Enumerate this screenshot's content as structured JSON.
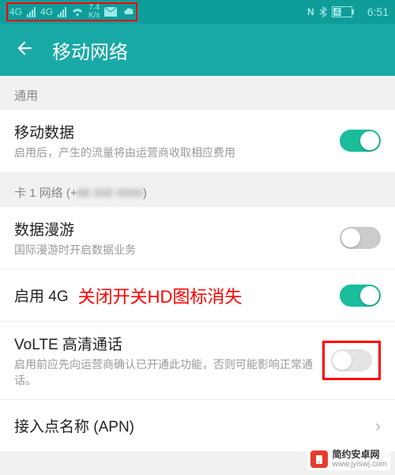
{
  "statusbar": {
    "network_type": "4G",
    "speed_value": "7.4",
    "speed_unit": "K/s",
    "nfc": "N",
    "battery_pct": "43",
    "time": "6:51"
  },
  "appbar": {
    "title": "移动网络"
  },
  "sections": {
    "general_label": "通用",
    "card1_prefix": "卡 1 网络 (+",
    "card1_number_blurred": "86 000 0000",
    "card1_suffix": ")"
  },
  "rows": {
    "mobile_data": {
      "title": "移动数据",
      "sub": "启用后，产生的流量将由运营商收取相应费用",
      "on": true
    },
    "roaming": {
      "title": "数据漫游",
      "sub": "国际漫游时开启数据业务",
      "on": false
    },
    "enable4g": {
      "title": "启用 4G",
      "annotation": "关闭开关HD图标消失",
      "on": true
    },
    "volte": {
      "title": "VoLTE 高清通话",
      "sub": "启用前应先向运营商确认已开通此功能，否则可能影响正常通话。",
      "on": false
    },
    "apn": {
      "title": "接入点名称 (APN)"
    }
  },
  "watermark": {
    "name": "简约安卓网",
    "url": "www.jyiswj.com"
  }
}
